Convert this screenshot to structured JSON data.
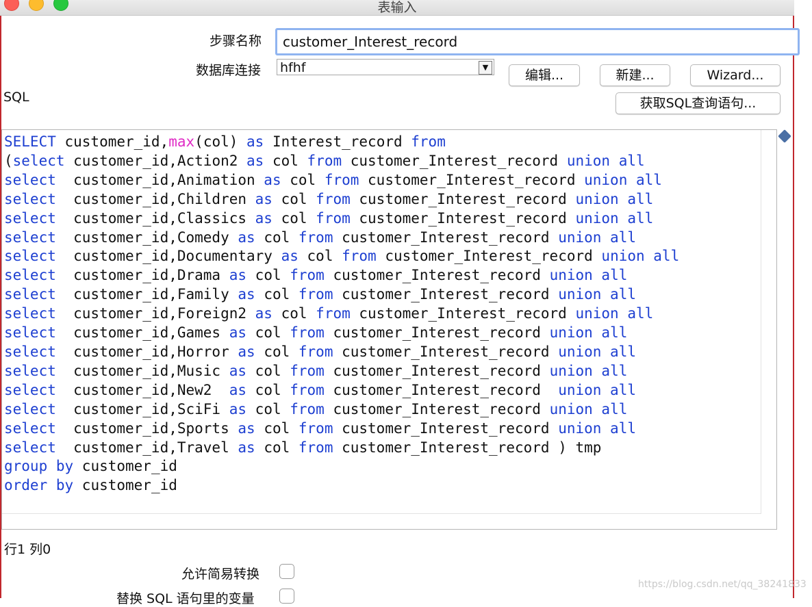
{
  "window": {
    "title": "表输入"
  },
  "form": {
    "step_name_label": "步骤名称",
    "step_name_value": "customer_Interest_record",
    "db_conn_label": "数据库连接",
    "db_conn_value": "hfhf",
    "edit_button": "编辑...",
    "new_button": "新建...",
    "wizard_button": "Wizard...",
    "sql_label": "SQL",
    "get_sql_button": "获取SQL查询语句..."
  },
  "sql": {
    "lines": [
      [
        [
          "kw",
          "SELECT"
        ],
        [
          "t",
          " customer_id,"
        ],
        [
          "fn",
          "max"
        ],
        [
          "t",
          "(col) "
        ],
        [
          "kw",
          "as"
        ],
        [
          "t",
          " Interest_record "
        ],
        [
          "kw",
          "from"
        ]
      ],
      [
        [
          "t",
          "("
        ],
        [
          "kw",
          "select"
        ],
        [
          "t",
          " customer_id,Action2 "
        ],
        [
          "kw",
          "as"
        ],
        [
          "t",
          " col "
        ],
        [
          "kw",
          "from"
        ],
        [
          "t",
          " customer_Interest_record "
        ],
        [
          "kw",
          "union all"
        ]
      ],
      [
        [
          "kw",
          "select"
        ],
        [
          "t",
          "  customer_id,Animation "
        ],
        [
          "kw",
          "as"
        ],
        [
          "t",
          " col "
        ],
        [
          "kw",
          "from"
        ],
        [
          "t",
          " customer_Interest_record "
        ],
        [
          "kw",
          "union all"
        ]
      ],
      [
        [
          "kw",
          "select"
        ],
        [
          "t",
          "  customer_id,Children "
        ],
        [
          "kw",
          "as"
        ],
        [
          "t",
          " col "
        ],
        [
          "kw",
          "from"
        ],
        [
          "t",
          " customer_Interest_record "
        ],
        [
          "kw",
          "union all"
        ]
      ],
      [
        [
          "kw",
          "select"
        ],
        [
          "t",
          "  customer_id,Classics "
        ],
        [
          "kw",
          "as"
        ],
        [
          "t",
          " col "
        ],
        [
          "kw",
          "from"
        ],
        [
          "t",
          " customer_Interest_record "
        ],
        [
          "kw",
          "union all"
        ]
      ],
      [
        [
          "kw",
          "select"
        ],
        [
          "t",
          "  customer_id,Comedy "
        ],
        [
          "kw",
          "as"
        ],
        [
          "t",
          " col "
        ],
        [
          "kw",
          "from"
        ],
        [
          "t",
          " customer_Interest_record "
        ],
        [
          "kw",
          "union all"
        ]
      ],
      [
        [
          "kw",
          "select"
        ],
        [
          "t",
          "  customer_id,Documentary "
        ],
        [
          "kw",
          "as"
        ],
        [
          "t",
          " col "
        ],
        [
          "kw",
          "from"
        ],
        [
          "t",
          " customer_Interest_record "
        ],
        [
          "kw",
          "union all"
        ]
      ],
      [
        [
          "kw",
          "select"
        ],
        [
          "t",
          "  customer_id,Drama "
        ],
        [
          "kw",
          "as"
        ],
        [
          "t",
          " col "
        ],
        [
          "kw",
          "from"
        ],
        [
          "t",
          " customer_Interest_record "
        ],
        [
          "kw",
          "union all"
        ]
      ],
      [
        [
          "kw",
          "select"
        ],
        [
          "t",
          "  customer_id,Family "
        ],
        [
          "kw",
          "as"
        ],
        [
          "t",
          " col "
        ],
        [
          "kw",
          "from"
        ],
        [
          "t",
          " customer_Interest_record "
        ],
        [
          "kw",
          "union all"
        ]
      ],
      [
        [
          "kw",
          "select"
        ],
        [
          "t",
          "  customer_id,Foreign2 "
        ],
        [
          "kw",
          "as"
        ],
        [
          "t",
          " col "
        ],
        [
          "kw",
          "from"
        ],
        [
          "t",
          " customer_Interest_record "
        ],
        [
          "kw",
          "union all"
        ]
      ],
      [
        [
          "kw",
          "select"
        ],
        [
          "t",
          "  customer_id,Games "
        ],
        [
          "kw",
          "as"
        ],
        [
          "t",
          " col "
        ],
        [
          "kw",
          "from"
        ],
        [
          "t",
          " customer_Interest_record "
        ],
        [
          "kw",
          "union all"
        ]
      ],
      [
        [
          "kw",
          "select"
        ],
        [
          "t",
          "  customer_id,Horror "
        ],
        [
          "kw",
          "as"
        ],
        [
          "t",
          " col "
        ],
        [
          "kw",
          "from"
        ],
        [
          "t",
          " customer_Interest_record "
        ],
        [
          "kw",
          "union all"
        ]
      ],
      [
        [
          "kw",
          "select"
        ],
        [
          "t",
          "  customer_id,Music "
        ],
        [
          "kw",
          "as"
        ],
        [
          "t",
          " col "
        ],
        [
          "kw",
          "from"
        ],
        [
          "t",
          " customer_Interest_record "
        ],
        [
          "kw",
          "union all"
        ]
      ],
      [
        [
          "kw",
          "select"
        ],
        [
          "t",
          "  customer_id,New2  "
        ],
        [
          "kw",
          "as"
        ],
        [
          "t",
          " col "
        ],
        [
          "kw",
          "from"
        ],
        [
          "t",
          " customer_Interest_record  "
        ],
        [
          "kw",
          "union all"
        ]
      ],
      [
        [
          "kw",
          "select"
        ],
        [
          "t",
          "  customer_id,SciFi "
        ],
        [
          "kw",
          "as"
        ],
        [
          "t",
          " col "
        ],
        [
          "kw",
          "from"
        ],
        [
          "t",
          " customer_Interest_record "
        ],
        [
          "kw",
          "union all"
        ]
      ],
      [
        [
          "kw",
          "select"
        ],
        [
          "t",
          "  customer_id,Sports "
        ],
        [
          "kw",
          "as"
        ],
        [
          "t",
          " col "
        ],
        [
          "kw",
          "from"
        ],
        [
          "t",
          " customer_Interest_record "
        ],
        [
          "kw",
          "union all"
        ]
      ],
      [
        [
          "kw",
          "select"
        ],
        [
          "t",
          "  customer_id,Travel "
        ],
        [
          "kw",
          "as"
        ],
        [
          "t",
          " col "
        ],
        [
          "kw",
          "from"
        ],
        [
          "t",
          " customer_Interest_record ) tmp"
        ]
      ],
      [
        [
          "kw",
          "group by"
        ],
        [
          "t",
          " customer_id"
        ]
      ],
      [
        [
          "kw",
          "order by"
        ],
        [
          "t",
          " customer_id"
        ]
      ]
    ]
  },
  "status": {
    "position": "行1 列0"
  },
  "options": {
    "lazy_conversion_label": "允许简易转换",
    "replace_vars_label": "替换 SQL 语句里的变量"
  },
  "watermark": "https://blog.csdn.net/qq_38241833",
  "colors": {
    "keyword": "#1d3fd1",
    "function": "#e02bc6",
    "focus_border": "#8fb4f0"
  }
}
